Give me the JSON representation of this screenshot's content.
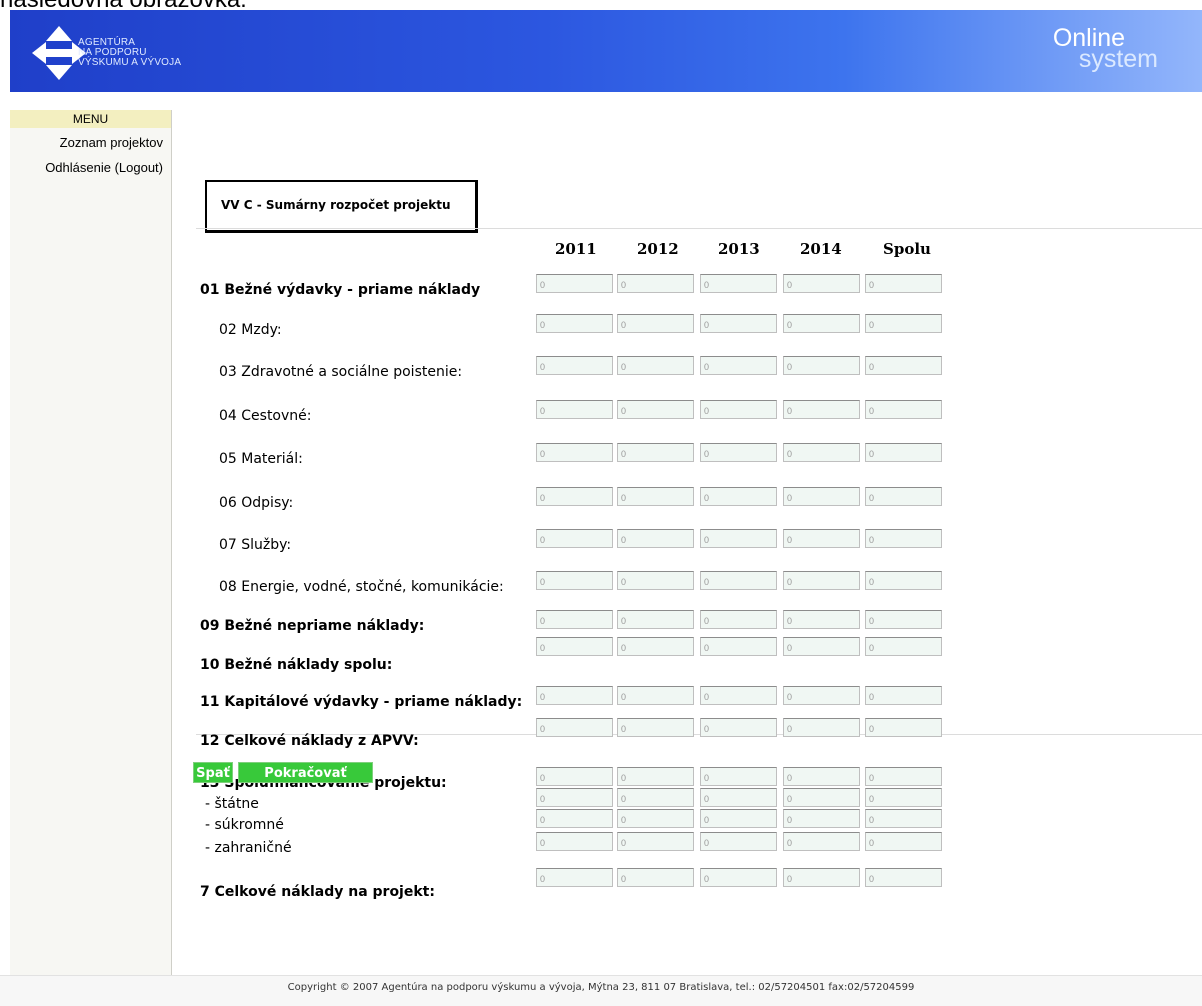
{
  "caption": "nasledovná obrazovka:",
  "header": {
    "agency_lines": [
      "AGENTÚRA",
      "NA PODPORU",
      "VÝSKUMU A VÝVOJA"
    ],
    "brand_line1": "Online",
    "brand_line2": "system",
    "colors": {
      "gradient_start": "#1f3fc9",
      "gradient_end": "#93b6fb"
    }
  },
  "sidebar": {
    "title": "MENU",
    "items": [
      {
        "label": "Zoznam projektov"
      },
      {
        "label": "Odhlásenie (Logout)"
      }
    ]
  },
  "form": {
    "tab_title": "VV C - Sumárny rozpočet projektu",
    "columns": [
      "2011",
      "2012",
      "2013",
      "2014",
      "Spolu"
    ],
    "rows": [
      {
        "label": "01 Bežné výdavky - priame náklady",
        "bold": true,
        "values": [
          "0",
          "0",
          "0",
          "0",
          "0"
        ]
      },
      {
        "label": "02 Mzdy:",
        "bold": false,
        "values": [
          "0",
          "0",
          "0",
          "0",
          "0"
        ]
      },
      {
        "label": "03 Zdravotné a sociálne poistenie:",
        "bold": false,
        "values": [
          "0",
          "0",
          "0",
          "0",
          "0"
        ]
      },
      {
        "label": "04 Cestovné:",
        "bold": false,
        "values": [
          "0",
          "0",
          "0",
          "0",
          "0"
        ]
      },
      {
        "label": "05 Materiál:",
        "bold": false,
        "values": [
          "0",
          "0",
          "0",
          "0",
          "0"
        ]
      },
      {
        "label": "06 Odpisy:",
        "bold": false,
        "values": [
          "0",
          "0",
          "0",
          "0",
          "0"
        ]
      },
      {
        "label": "07 Služby:",
        "bold": false,
        "values": [
          "0",
          "0",
          "0",
          "0",
          "0"
        ]
      },
      {
        "label": "08 Energie, vodné, stočné, komunikácie:",
        "bold": false,
        "values": [
          "0",
          "0",
          "0",
          "0",
          "0"
        ]
      },
      {
        "label": "09 Bežné nepriame náklady:",
        "bold": true,
        "values": [
          "0",
          "0",
          "0",
          "0",
          "0"
        ]
      },
      {
        "label": "10 Bežné náklady spolu:",
        "bold": true,
        "values": [
          "0",
          "0",
          "0",
          "0",
          "0"
        ]
      },
      {
        "label": "11 Kapitálové výdavky - priame náklady:",
        "bold": true,
        "values": [
          "0",
          "0",
          "0",
          "0",
          "0"
        ]
      },
      {
        "label": "12 Celkové náklady z APVV:",
        "bold": true,
        "values": [
          "0",
          "0",
          "0",
          "0",
          "0"
        ]
      },
      {
        "label": "13 Spolufinancovanie projektu:",
        "bold": true,
        "values": [
          "0",
          "0",
          "0",
          "0",
          "0"
        ]
      },
      {
        "label": "- štátne",
        "bold": false,
        "values": [
          "0",
          "0",
          "0",
          "0",
          "0"
        ]
      },
      {
        "label": "- súkromné",
        "bold": false,
        "values": [
          "0",
          "0",
          "0",
          "0",
          "0"
        ]
      },
      {
        "label": "- zahraničné",
        "bold": false,
        "values": [
          "0",
          "0",
          "0",
          "0",
          "0"
        ]
      },
      {
        "label": "7 Celkové náklady na projekt:",
        "bold": true,
        "values": [
          "0",
          "0",
          "0",
          "0",
          "0"
        ]
      }
    ]
  },
  "buttons": {
    "back": "Spať",
    "next": "Pokračovať"
  },
  "footer": {
    "text": "Copyright © 2007 Agentúra na podporu výskumu a vývoja, Mýtna 23, 811 07 Bratislava, tel.: 02/57204501 fax:02/57204599"
  }
}
